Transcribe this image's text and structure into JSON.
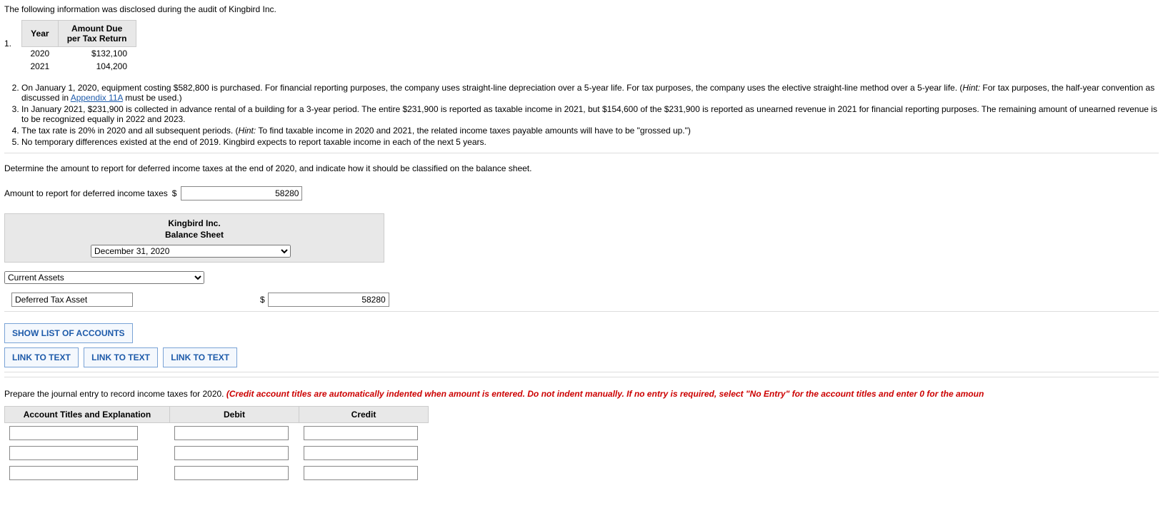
{
  "intro": "The following information was disclosed during the audit of Kingbird Inc.",
  "item1_num": "1.",
  "table1": {
    "col_year": "Year",
    "col_amount": "Amount Due\nper Tax Return",
    "rows": [
      {
        "year": "2020",
        "amount": "$132,100"
      },
      {
        "year": "2021",
        "amount": "104,200"
      }
    ]
  },
  "list_items": {
    "i2a": "On January 1, 2020, equipment costing $582,800 is purchased. For financial reporting purposes, the company uses straight-line depreciation over a 5-year life. For tax purposes, the company uses the elective straight-line method over a 5-year life. (",
    "i2_hint": "Hint:",
    "i2b": " For tax purposes, the half-year convention as discussed in ",
    "i2_link": "Appendix 11A",
    "i2c": " must be used.)",
    "i3": "In January 2021, $231,900 is collected in advance rental of a building for a 3-year period. The entire $231,900 is reported as taxable income in 2021, but $154,600 of the $231,900 is reported as unearned revenue in 2021 for financial reporting purposes. The remaining amount of unearned revenue is to be recognized equally in 2022 and 2023.",
    "i4a": "The tax rate is 20% in 2020 and all subsequent periods. (",
    "i4_hint": "Hint:",
    "i4b": " To find taxable income in 2020 and 2021, the related income taxes payable amounts will have to be \"grossed up.\")",
    "i5": "No temporary differences existed at the end of 2019. Kingbird expects to report taxable income in each of the next 5 years."
  },
  "question": "Determine the amount to report for deferred income taxes at the end of 2020, and indicate how it should be classified on the balance sheet.",
  "amount_label": "Amount to report for deferred income taxes",
  "amount_value": "58280",
  "dollar": "$",
  "bs": {
    "title1": "Kingbird Inc.",
    "title2": "Balance Sheet",
    "date_option": "December 31, 2020",
    "section_option": "Current Assets",
    "acct": "Deferred Tax Asset",
    "acct_amount": "58280"
  },
  "buttons": {
    "show": "SHOW LIST OF ACCOUNTS",
    "link": "LINK TO TEXT"
  },
  "je_intro": "Prepare the journal entry to record income taxes for 2020. ",
  "je_red": "(Credit account titles are automatically indented when amount is entered. Do not indent manually. If no entry is required, select \"No Entry\" for the account titles and enter 0 for the amoun",
  "je_headers": {
    "acct": "Account Titles and Explanation",
    "debit": "Debit",
    "credit": "Credit"
  }
}
